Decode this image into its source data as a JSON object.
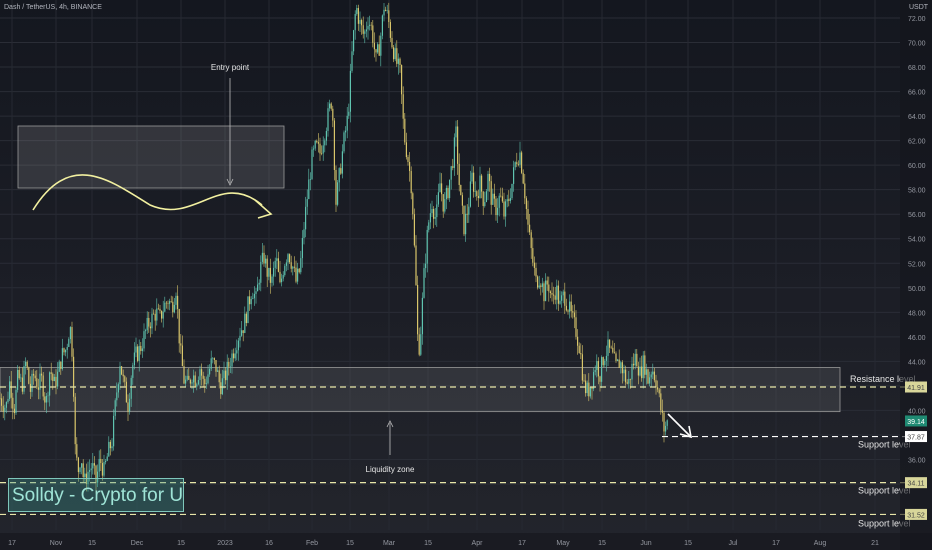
{
  "header": {
    "symbol_line": "Dash / TetherUS, 4h, BINANCE",
    "currency": "USDT"
  },
  "annotations": {
    "entry_point": "Entry point",
    "liquidity_zone": "Liquidity zone",
    "resistance_label": "Resistance level",
    "support_labels": [
      "Support level",
      "Support level",
      "Support level"
    ]
  },
  "watermark": "Solldy - Crypto for U",
  "chart_data": {
    "type": "candlestick",
    "title": "Dash / TetherUS, 4h, BINANCE",
    "ylabel": "USDT",
    "ylim": [
      30.5,
      73.5
    ],
    "y_ticks": [
      34.0,
      36.0,
      38.0,
      40.0,
      42.0,
      44.0,
      46.0,
      48.0,
      50.0,
      52.0,
      54.0,
      56.0,
      58.0,
      60.0,
      62.0,
      64.0,
      66.0,
      68.0,
      70.0,
      72.0
    ],
    "x_ticks": [
      "17",
      "Nov",
      "15",
      "Dec",
      "15",
      "2023",
      "16",
      "Feb",
      "15",
      "Mar",
      "15",
      "Apr",
      "17",
      "May",
      "15",
      "Jun",
      "15",
      "Jul",
      "17",
      "Aug",
      "21"
    ],
    "grid": true,
    "colors": {
      "up": "#5fc4b0",
      "down": "#d9c66b",
      "accent": "#f2f0a0"
    },
    "price_path": [
      [
        0,
        41.0
      ],
      [
        6,
        40.2
      ],
      [
        10,
        42.5
      ],
      [
        14,
        40.0
      ],
      [
        18,
        42.8
      ],
      [
        22,
        42.0
      ],
      [
        26,
        44.0
      ],
      [
        30,
        41.5
      ],
      [
        34,
        43.0
      ],
      [
        38,
        42.0
      ],
      [
        42,
        42.5
      ],
      [
        46,
        40.5
      ],
      [
        50,
        43.5
      ],
      [
        54,
        42.0
      ],
      [
        58,
        43.0
      ],
      [
        62,
        44.5
      ],
      [
        66,
        45.0
      ],
      [
        70,
        47.0
      ],
      [
        73,
        44.0
      ],
      [
        75,
        37.0
      ],
      [
        78,
        35.0
      ],
      [
        81,
        36.5
      ],
      [
        84,
        34.0
      ],
      [
        88,
        35.0
      ],
      [
        92,
        35.5
      ],
      [
        96,
        34.2
      ],
      [
        100,
        36.0
      ],
      [
        104,
        35.0
      ],
      [
        108,
        36.5
      ],
      [
        112,
        37.5
      ],
      [
        116,
        41.0
      ],
      [
        120,
        44.0
      ],
      [
        124,
        42.0
      ],
      [
        128,
        40.5
      ],
      [
        132,
        43.5
      ],
      [
        136,
        44.5
      ],
      [
        140,
        45.0
      ],
      [
        144,
        46.0
      ],
      [
        148,
        47.0
      ],
      [
        152,
        47.5
      ],
      [
        156,
        48.0
      ],
      [
        160,
        47.5
      ],
      [
        164,
        48.5
      ],
      [
        168,
        49.0
      ],
      [
        172,
        48.5
      ],
      [
        176,
        50.0
      ],
      [
        180,
        45.0
      ],
      [
        184,
        42.5
      ],
      [
        188,
        42.0
      ],
      [
        192,
        43.0
      ],
      [
        196,
        42.5
      ],
      [
        200,
        43.5
      ],
      [
        204,
        42.0
      ],
      [
        208,
        43.0
      ],
      [
        212,
        44.0
      ],
      [
        216,
        43.5
      ],
      [
        220,
        42.0
      ],
      [
        224,
        42.5
      ],
      [
        228,
        43.5
      ],
      [
        232,
        44.5
      ],
      [
        236,
        45.5
      ],
      [
        240,
        46.5
      ],
      [
        244,
        47.0
      ],
      [
        248,
        48.5
      ],
      [
        252,
        50.0
      ],
      [
        256,
        49.0
      ],
      [
        260,
        51.5
      ],
      [
        264,
        52.5
      ],
      [
        268,
        51.0
      ],
      [
        272,
        50.5
      ],
      [
        276,
        52.5
      ],
      [
        280,
        50.0
      ],
      [
        284,
        52.0
      ],
      [
        288,
        53.0
      ],
      [
        292,
        52.0
      ],
      [
        296,
        50.5
      ],
      [
        300,
        51.5
      ],
      [
        304,
        55.0
      ],
      [
        308,
        58.0
      ],
      [
        312,
        60.5
      ],
      [
        316,
        61.5
      ],
      [
        320,
        61.0
      ],
      [
        324,
        62.5
      ],
      [
        328,
        64.0
      ],
      [
        332,
        65.5
      ],
      [
        336,
        57.0
      ],
      [
        340,
        59.5
      ],
      [
        344,
        62.0
      ],
      [
        348,
        64.0
      ],
      [
        352,
        69.0
      ],
      [
        356,
        73.0
      ],
      [
        360,
        71.5
      ],
      [
        364,
        70.5
      ],
      [
        368,
        72.0
      ],
      [
        372,
        71.0
      ],
      [
        376,
        68.5
      ],
      [
        380,
        70.0
      ],
      [
        384,
        73.0
      ],
      [
        388,
        72.0
      ],
      [
        392,
        70.0
      ],
      [
        396,
        68.5
      ],
      [
        400,
        67.5
      ],
      [
        404,
        62.5
      ],
      [
        408,
        60.5
      ],
      [
        412,
        58.0
      ],
      [
        416,
        50.0
      ],
      [
        418,
        45.0
      ],
      [
        420,
        45.5
      ],
      [
        424,
        51.0
      ],
      [
        428,
        55.0
      ],
      [
        432,
        57.0
      ],
      [
        436,
        55.5
      ],
      [
        440,
        58.5
      ],
      [
        444,
        56.5
      ],
      [
        448,
        58.0
      ],
      [
        452,
        60.0
      ],
      [
        456,
        62.5
      ],
      [
        460,
        57.5
      ],
      [
        464,
        55.0
      ],
      [
        468,
        56.5
      ],
      [
        472,
        59.0
      ],
      [
        476,
        57.5
      ],
      [
        480,
        58.5
      ],
      [
        484,
        57.0
      ],
      [
        488,
        59.0
      ],
      [
        492,
        57.0
      ],
      [
        496,
        56.5
      ],
      [
        500,
        57.5
      ],
      [
        504,
        56.0
      ],
      [
        508,
        57.0
      ],
      [
        512,
        58.5
      ],
      [
        516,
        60.5
      ],
      [
        520,
        61.0
      ],
      [
        524,
        58.5
      ],
      [
        528,
        55.0
      ],
      [
        532,
        52.5
      ],
      [
        536,
        50.5
      ],
      [
        540,
        51.0
      ],
      [
        544,
        49.5
      ],
      [
        548,
        50.5
      ],
      [
        552,
        49.0
      ],
      [
        556,
        50.0
      ],
      [
        560,
        48.5
      ],
      [
        564,
        49.5
      ],
      [
        568,
        48.5
      ],
      [
        572,
        47.5
      ],
      [
        576,
        46.5
      ],
      [
        580,
        45.0
      ],
      [
        584,
        42.0
      ],
      [
        588,
        41.5
      ],
      [
        592,
        42.5
      ],
      [
        596,
        44.0
      ],
      [
        600,
        43.0
      ],
      [
        604,
        44.5
      ],
      [
        608,
        45.0
      ],
      [
        612,
        44.5
      ],
      [
        616,
        43.5
      ],
      [
        620,
        44.0
      ],
      [
        624,
        43.0
      ],
      [
        628,
        42.0
      ],
      [
        632,
        43.5
      ],
      [
        636,
        44.5
      ],
      [
        640,
        43.0
      ],
      [
        644,
        44.0
      ],
      [
        648,
        42.5
      ],
      [
        652,
        43.5
      ],
      [
        656,
        42.5
      ],
      [
        660,
        40.5
      ],
      [
        664,
        38.5
      ],
      [
        668,
        39.14
      ]
    ],
    "levels": [
      {
        "name": "Resistance level",
        "value": 41.91
      },
      {
        "name": "Support level",
        "value": 37.87
      },
      {
        "name": "Support level",
        "value": 34.11
      },
      {
        "name": "Support level",
        "value": 31.52
      }
    ],
    "zones": [
      {
        "name": "Liquidity zone",
        "from": 39.9,
        "to": 43.5
      }
    ],
    "last_price": 39.14,
    "level_badges": [
      "41.91",
      "37.87",
      "34.11",
      "31.52"
    ]
  }
}
